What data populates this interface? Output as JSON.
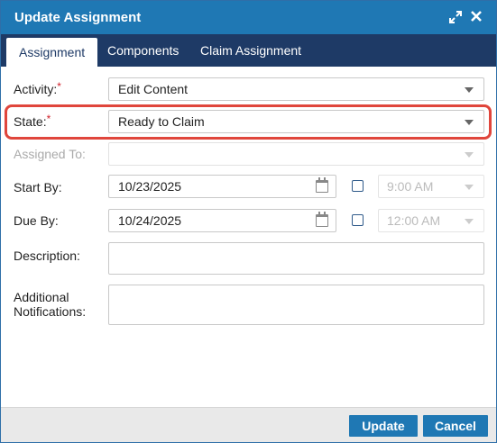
{
  "dialog": {
    "title": "Update Assignment"
  },
  "tabs": [
    {
      "label": "Assignment",
      "active": true
    },
    {
      "label": "Components",
      "active": false
    },
    {
      "label": "Claim Assignment",
      "active": false
    }
  ],
  "form": {
    "activity": {
      "label": "Activity:",
      "required_mark": "*",
      "value": "Edit Content"
    },
    "state": {
      "label": "State:",
      "required_mark": "*",
      "value": "Ready to Claim"
    },
    "assigned_to": {
      "label": "Assigned To:",
      "value": ""
    },
    "start_by": {
      "label": "Start By:",
      "date": "10/23/2025",
      "time": "9:00 AM",
      "time_enabled": false
    },
    "due_by": {
      "label": "Due By:",
      "date": "10/24/2025",
      "time": "12:00 AM",
      "time_enabled": false
    },
    "description": {
      "label": "Description:",
      "value": ""
    },
    "additional_notifications": {
      "label_line1": "Additional",
      "label_line2": "Notifications:",
      "value": ""
    }
  },
  "footer": {
    "update_label": "Update",
    "cancel_label": "Cancel"
  },
  "colors": {
    "titlebar": "#1f78b4",
    "tabbar": "#1e3a66",
    "required": "#d0202a",
    "highlight": "#e0463c",
    "button": "#1f78b4"
  },
  "icons": {
    "expand": "expand-arrows-icon",
    "close": "close-icon",
    "calendar": "calendar-icon",
    "dropdown": "chevron-down-icon"
  }
}
